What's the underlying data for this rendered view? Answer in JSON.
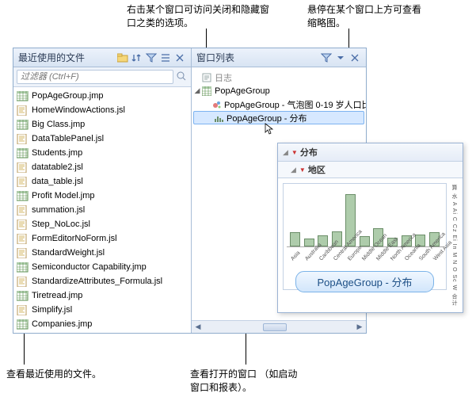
{
  "callouts": {
    "top_left": "右击某个窗口可访问关闭和隐藏窗\n口之类的选项。",
    "top_right": "悬停在某个窗口上方可查看\n缩略图。",
    "bottom_left": "查看最近使用的文件。",
    "bottom_right": "查看打开的窗口 （如启动\n窗口和报表）。"
  },
  "left_panel": {
    "title": "最近使用的文件",
    "filter_placeholder": "过滤器 (Ctrl+F)",
    "files": [
      {
        "name": "PopAgeGroup.jmp",
        "type": "jmp"
      },
      {
        "name": "HomeWindowActions.jsl",
        "type": "jsl"
      },
      {
        "name": "Big Class.jmp",
        "type": "jmp"
      },
      {
        "name": "DataTablePanel.jsl",
        "type": "jsl"
      },
      {
        "name": "Students.jmp",
        "type": "jmp"
      },
      {
        "name": "datatable2.jsl",
        "type": "jsl"
      },
      {
        "name": "data_table.jsl",
        "type": "jsl"
      },
      {
        "name": "Profit Model.jmp",
        "type": "jmp"
      },
      {
        "name": "summation.jsl",
        "type": "jsl"
      },
      {
        "name": "Step_NoLoc.jsl",
        "type": "jsl"
      },
      {
        "name": "FormEditorNoForm.jsl",
        "type": "jsl"
      },
      {
        "name": "StandardWeight.jsl",
        "type": "jsl"
      },
      {
        "name": "Semiconductor Capability.jmp",
        "type": "jmp"
      },
      {
        "name": "StandardizeAttributes_Formula.jsl",
        "type": "jsl"
      },
      {
        "name": "Tiretread.jmp",
        "type": "jmp"
      },
      {
        "name": "Simplify.jsl",
        "type": "jsl"
      },
      {
        "name": "Companies.jmp",
        "type": "jmp"
      }
    ]
  },
  "right_panel": {
    "title": "窗口列表",
    "tree": {
      "log": "日志",
      "root": "PopAgeGroup",
      "children": [
        {
          "label": "PopAgeGroup - 气泡图 0-19 岁人口比",
          "icon": "bubble"
        },
        {
          "label": "PopAgeGroup - 分布",
          "icon": "dist",
          "selected": true
        }
      ]
    }
  },
  "thumbnail": {
    "title": "分布",
    "subtitle": "地区",
    "chip": "PopAgeGroup - 分布",
    "yaxis_text": "算 水 A Ai C Cz Ei In M N O Sc W 合计"
  },
  "chart_data": {
    "type": "bar",
    "title": "地区",
    "categories": [
      "Asia",
      "Australia",
      "Caribbean",
      "Central America",
      "Europe",
      "Middle Ocean",
      "Middle East",
      "North America",
      "Oceania",
      "South America",
      "West Asia"
    ],
    "values": [
      14,
      8,
      11,
      15,
      52,
      10,
      18,
      9,
      11,
      12,
      14
    ],
    "ylim": [
      0,
      55
    ],
    "xlabel": "",
    "ylabel": ""
  },
  "colors": {
    "accent": "#7bb3e8",
    "bar_fill": "#aeccab",
    "bar_stroke": "#6b8e68"
  }
}
